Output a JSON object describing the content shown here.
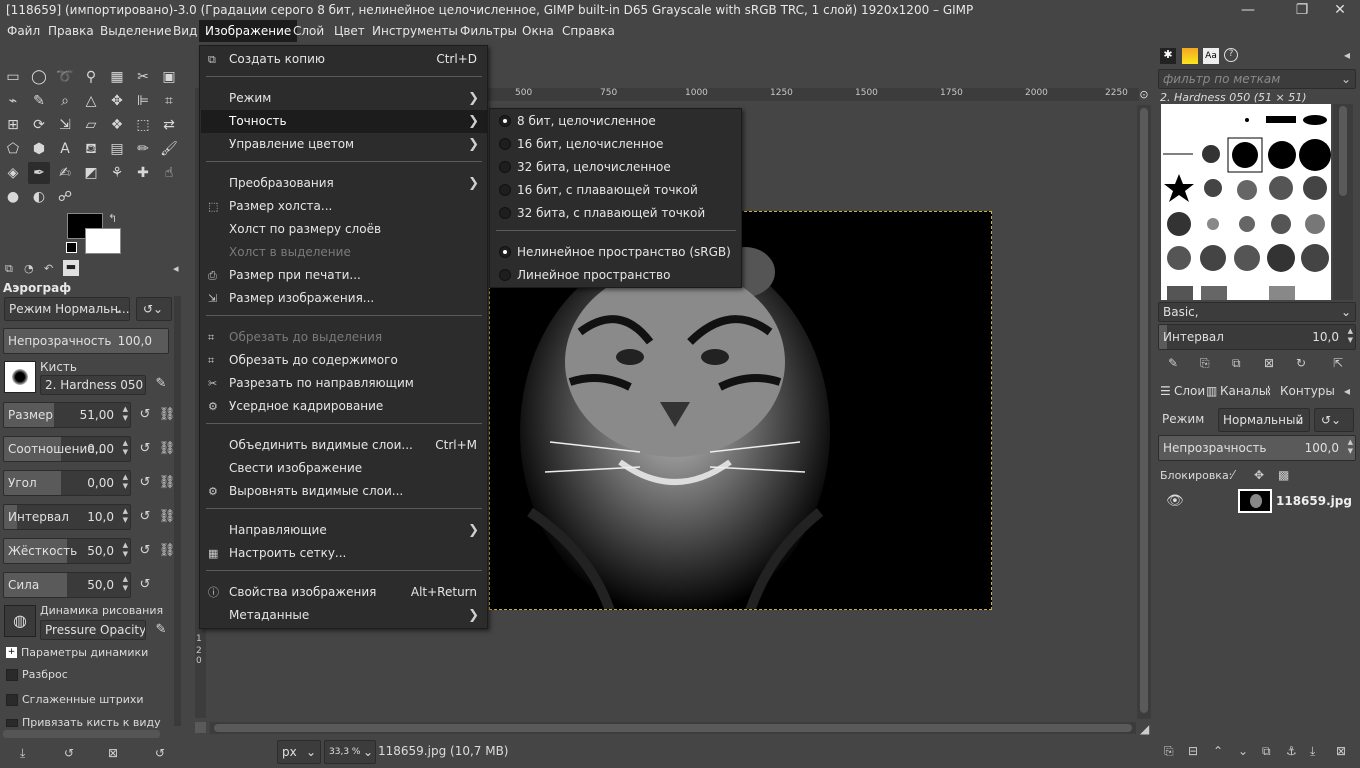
{
  "window": {
    "title": "[118659] (импортировано)-3.0 (Градации серого 8 бит, нелинейное целочисленное, GIMP built-in D65 Grayscale with sRGB TRC, 1 слой) 1920x1200 – GIMP",
    "minimize": "—",
    "maximize": "❐",
    "close": "✕"
  },
  "menubar": [
    "Файл",
    "Правка",
    "Выделение",
    "Вид",
    "Изображение",
    "Слой",
    "Цвет",
    "Инструменты",
    "Фильтры",
    "Окна",
    "Справка"
  ],
  "image_menu": {
    "items": [
      {
        "label": "Создать копию",
        "shortcut": "Ctrl+D",
        "icon": "duplicate-icon"
      },
      {
        "label": "Режим",
        "submenu": true
      },
      {
        "label": "Точность",
        "submenu": true,
        "highlighted": true
      },
      {
        "label": "Управление цветом",
        "submenu": true
      },
      {
        "label": "Преобразования",
        "submenu": true
      },
      {
        "label": "Размер холста...",
        "icon": "canvas-size-icon"
      },
      {
        "label": "Холст по размеру слоёв"
      },
      {
        "label": "Холст в выделение",
        "disabled": true
      },
      {
        "label": "Размер при печати...",
        "icon": "print-size-icon"
      },
      {
        "label": "Размер изображения...",
        "icon": "scale-image-icon"
      },
      {
        "label": "Обрезать до выделения",
        "disabled": true,
        "icon": "crop-icon"
      },
      {
        "label": "Обрезать до содержимого",
        "icon": "crop-content-icon"
      },
      {
        "label": "Разрезать по направляющим",
        "icon": "slice-icon"
      },
      {
        "label": "Усердное кадрирование",
        "icon": "zealous-crop-icon"
      },
      {
        "label": "Объединить видимые слои...",
        "shortcut": "Ctrl+M"
      },
      {
        "label": "Свести изображение"
      },
      {
        "label": "Выровнять видимые слои...",
        "icon": "align-icon"
      },
      {
        "label": "Направляющие",
        "submenu": true
      },
      {
        "label": "Настроить сетку...",
        "icon": "grid-icon"
      },
      {
        "label": "Свойства изображения",
        "shortcut": "Alt+Return",
        "icon": "info-icon"
      },
      {
        "label": "Метаданные",
        "submenu": true
      }
    ]
  },
  "precision_submenu": {
    "items": [
      {
        "label": "8 бит, целочисленное",
        "checked": true
      },
      {
        "label": "16 бит, целочисленное",
        "checked": false
      },
      {
        "label": "32 бита, целочисленное",
        "checked": false
      },
      {
        "label": "16 бит, с плавающей точкой",
        "checked": false
      },
      {
        "label": "32 бита, с плавающей точкой",
        "checked": false
      },
      {
        "label": "Нелинейное пространство (sRGB)",
        "checked": true
      },
      {
        "label": "Линейное пространство",
        "checked": false
      }
    ]
  },
  "tool_options": {
    "title": "Аэрограф",
    "mode": "Режим Нормальн...",
    "opacity": {
      "label": "Непрозрачность",
      "value": "100,0"
    },
    "brush_label": "Кисть",
    "brush_name": "2. Hardness 050",
    "size": {
      "label": "Размер",
      "value": "51,00"
    },
    "ratio": {
      "label": "Соотношение...",
      "value": "0,00"
    },
    "angle": {
      "label": "Угол",
      "value": "0,00"
    },
    "spacing": {
      "label": "Интервал",
      "value": "10,0"
    },
    "hardness": {
      "label": "Жёсткость",
      "value": "50,0"
    },
    "force": {
      "label": "Сила",
      "value": "50,0"
    },
    "dynamics_label": "Динамика рисования",
    "dynamics_name": "Pressure Opacity",
    "dynamics_params": "Параметры динамики",
    "scatter": "Разброс",
    "smooth": "Сглаженные штрихи",
    "lock_brush": "Привязать кисть к виду"
  },
  "ruler": {
    "ticks": [
      "500",
      "750",
      "1000",
      "1250",
      "1500",
      "1750",
      "2000",
      "2250"
    ],
    "vticks": [
      "1",
      "2",
      "0"
    ]
  },
  "statusbar": {
    "unit": "px",
    "zoom": "33,3 %",
    "file": "118659.jpg (10,7 MB)"
  },
  "brushes": {
    "filter_placeholder": "фильтр по меткам",
    "current": "2. Hardness 050 (51 × 51)",
    "preset": "Basic,",
    "spacing_label": "Интервал",
    "spacing_value": "10,0"
  },
  "layers": {
    "tabs": [
      "Слои",
      "Каналы",
      "Контуры"
    ],
    "mode_label": "Режим",
    "mode_value": "Нормальный",
    "opacity_label": "Непрозрачность",
    "opacity_value": "100,0",
    "lock_label": "Блокировка:",
    "layer_name": "118659.jpg"
  }
}
